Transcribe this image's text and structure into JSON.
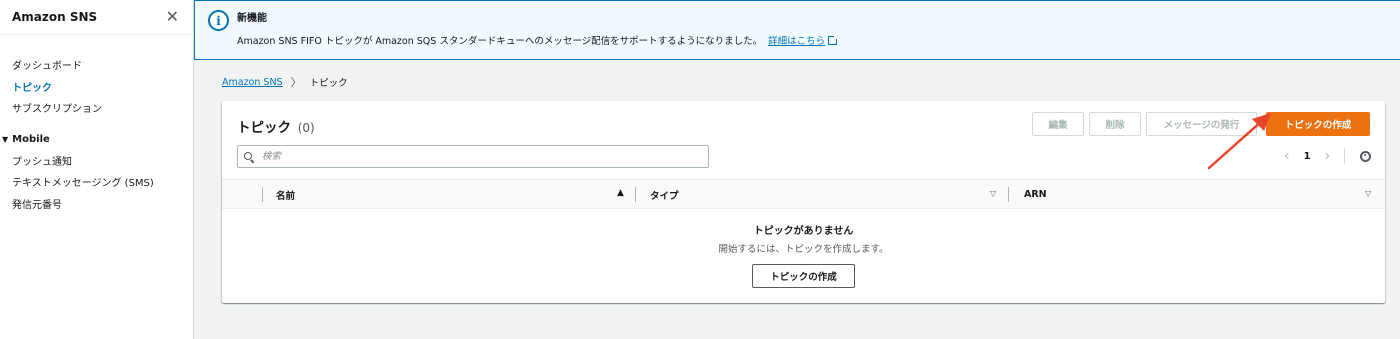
{
  "sidebar": {
    "title": "Amazon SNS",
    "close_icon": "close-icon",
    "items": [
      {
        "label": "ダッシュボード",
        "active": false
      },
      {
        "label": "トピック",
        "active": true
      },
      {
        "label": "サブスクリプション",
        "active": false
      }
    ],
    "section": {
      "label": "Mobile",
      "items": [
        {
          "label": "プッシュ通知"
        },
        {
          "label": "テキストメッセージング (SMS)"
        },
        {
          "label": "発信元番号"
        }
      ]
    }
  },
  "flash": {
    "icon": "info-icon",
    "title": "新機能",
    "message": "Amazon SNS FIFO トピックが Amazon SQS スタンダードキューへのメッセージ配信をサポートするようになりました。",
    "link": "詳細はこちら"
  },
  "breadcrumb": {
    "root": "Amazon SNS",
    "current": "トピック"
  },
  "panel": {
    "title": "トピック",
    "count": "(0)",
    "buttons": {
      "edit": "編集",
      "delete": "削除",
      "publish": "メッセージの発行",
      "create": "トピックの作成"
    },
    "search": {
      "placeholder": "検索",
      "value": ""
    },
    "pagination": {
      "page": "1"
    },
    "columns": [
      {
        "label": "名前",
        "sort": "ascending"
      },
      {
        "label": "タイプ",
        "sort": "none"
      },
      {
        "label": "ARN",
        "sort": "none"
      }
    ],
    "empty": {
      "title": "トピックがありません",
      "subtitle": "開始するには、トピックを作成します。",
      "button": "トピックの作成"
    }
  },
  "colors": {
    "accent": "#0073bb",
    "primary_button": "#ec7211",
    "annotation_arrow": "#e8452c"
  }
}
